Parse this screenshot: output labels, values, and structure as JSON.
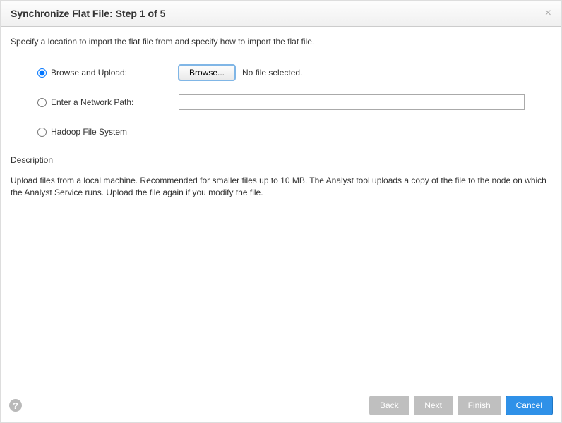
{
  "header": {
    "title": "Synchronize Flat File: Step 1 of 5",
    "close_symbol": "×"
  },
  "instruction": "Specify a location to import the flat file from and specify how to import the flat file.",
  "options": {
    "browse": {
      "label": "Browse and Upload:",
      "selected": true
    },
    "network": {
      "label": "Enter a Network Path:",
      "selected": false,
      "value": ""
    },
    "hadoop": {
      "label": "Hadoop File System",
      "selected": false
    }
  },
  "browse": {
    "button_label": "Browse...",
    "file_status": "No file selected."
  },
  "description": {
    "label": "Description",
    "text": "Upload files from a local machine. Recommended for smaller files up to 10 MB. The Analyst tool uploads a copy of the file to the node on which the Analyst Service runs. Upload the file again if you modify the file."
  },
  "footer": {
    "help_symbol": "?",
    "back": "Back",
    "next": "Next",
    "finish": "Finish",
    "cancel": "Cancel"
  }
}
